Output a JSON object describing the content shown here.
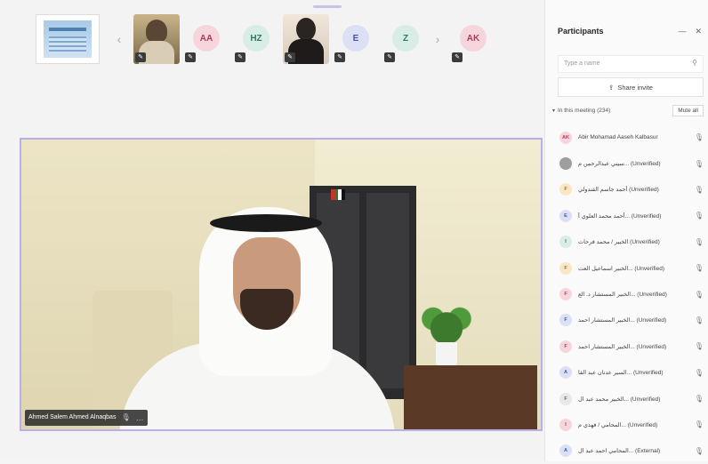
{
  "gallery": {
    "prev_icon": "‹",
    "next_icon": "›",
    "tiles": [
      {
        "kind": "video-a",
        "badge": "✎"
      },
      {
        "kind": "avatar",
        "initials": "AA",
        "bg": "#f6d6dc",
        "fg": "#b23a56",
        "badge": "✎"
      },
      {
        "kind": "avatar",
        "initials": "HZ",
        "bg": "#d7ede6",
        "fg": "#2f7a62",
        "badge": "✎"
      },
      {
        "kind": "video-b",
        "badge": "✎"
      },
      {
        "kind": "avatar",
        "initials": "E",
        "bg": "#dbe0f5",
        "fg": "#4057a8",
        "badge": "✎"
      },
      {
        "kind": "avatar",
        "initials": "Z",
        "bg": "#d7ede6",
        "fg": "#2f7a62",
        "badge": "✎"
      },
      {
        "kind": "avatar",
        "initials": "AK",
        "bg": "#f6d6dc",
        "fg": "#b23a56",
        "badge": "✎"
      }
    ]
  },
  "main_video": {
    "speaker_name": "Ahmed Salem Ahmed Alnaqbas",
    "mic_icon": "🎙",
    "more_icon": "…"
  },
  "panel": {
    "title": "Participants",
    "minimize_icon": "—",
    "close_icon": "✕",
    "search_placeholder": "Type a name",
    "search_icon": "⚲",
    "share_invite_icon": "⇪",
    "share_invite_label": "Share invite",
    "in_meeting_label": "In this meeting (234)",
    "mute_all_label": "Mute all",
    "participants": [
      {
        "initials": "AK",
        "name": "Abir Mohamad Aaseh Kalbasur",
        "bg": "#f6d6dc",
        "fg": "#b23a56"
      },
      {
        "initials": "",
        "name": "سيني عبدالرحمن م... (Unverified)",
        "bg": "#9e9e9e",
        "fg": "#ffffff"
      },
      {
        "initials": "F",
        "name": "أحمد جاسم القندولي (Unverified)",
        "bg": "#fbe7c8",
        "fg": "#a96f12"
      },
      {
        "initials": "E",
        "name": "أحمد محمد العلوي أ... (Unverified)",
        "bg": "#dbe0f5",
        "fg": "#4057a8"
      },
      {
        "initials": "I",
        "name": "الخبير / محمد فرحات (Unverified)",
        "bg": "#d7ede6",
        "fg": "#2f7a62"
      },
      {
        "initials": "F",
        "name": "الخبير اسماعيل العت... (Unverified)",
        "bg": "#fbe7c8",
        "fg": "#a96f12"
      },
      {
        "initials": "F",
        "name": "الخبير المستشار د. الع... (Unverified)",
        "bg": "#f6d6dc",
        "fg": "#b23a56"
      },
      {
        "initials": "F",
        "name": "الخبير المستشار احمد... (Unverified)",
        "bg": "#dbe0f5",
        "fg": "#4057a8"
      },
      {
        "initials": "F",
        "name": "الخبير المستشار احمد... (Unverified)",
        "bg": "#f6d6dc",
        "fg": "#b23a56"
      },
      {
        "initials": "A",
        "name": "السير عدنان عبد القا... (Unverified)",
        "bg": "#dbe0f5",
        "fg": "#4057a8"
      },
      {
        "initials": "F",
        "name": "الخبير محمد عبد ال... (Unverified)",
        "bg": "#e8e8e8",
        "fg": "#666666"
      },
      {
        "initials": "I",
        "name": "المحامي / فهدي م... (Unverified)",
        "bg": "#f6d6dc",
        "fg": "#b23a56"
      },
      {
        "initials": "A",
        "name": "المحامي احمد عبد ال... (External)",
        "bg": "#dbe0f5",
        "fg": "#4057a8"
      }
    ],
    "mic_icon": "🎙"
  }
}
